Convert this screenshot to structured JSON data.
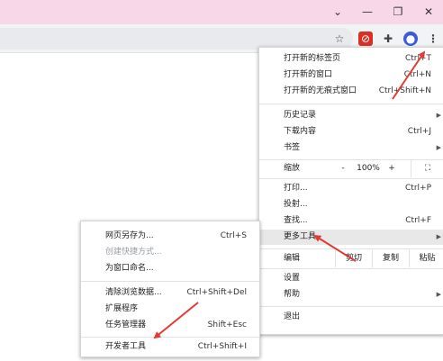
{
  "window": {
    "minimize_icon": "—",
    "restore_icon": "❐",
    "close_icon": "✕",
    "tab_dropdown_icon": "⌄"
  },
  "toolbar": {
    "star_icon": "☆",
    "ext1_icon": "⊘",
    "puzzle_icon": "✚",
    "profile_icon": "●",
    "menu_icon": "⋮"
  },
  "menu": {
    "items": [
      {
        "label": "打开新的标签页",
        "shortcut": "Ctrl+T"
      },
      {
        "label": "打开新的窗口",
        "shortcut": "Ctrl+N"
      },
      {
        "label": "打开新的无痕式窗口",
        "shortcut": "Ctrl+Shift+N"
      },
      {
        "label": "历史记录",
        "shortcut": ""
      },
      {
        "label": "下载内容",
        "shortcut": "Ctrl+J"
      },
      {
        "label": "书签",
        "shortcut": ""
      },
      {
        "label": "打印...",
        "shortcut": "Ctrl+P"
      },
      {
        "label": "投射...",
        "shortcut": ""
      },
      {
        "label": "查找...",
        "shortcut": "Ctrl+F"
      },
      {
        "label": "更多工具",
        "shortcut": ""
      },
      {
        "label": "设置",
        "shortcut": ""
      },
      {
        "label": "帮助",
        "shortcut": ""
      },
      {
        "label": "退出",
        "shortcut": ""
      }
    ],
    "zoom": {
      "label": "缩放",
      "minus": "-",
      "value": "100%",
      "plus": "+",
      "fullscreen_icon": "⛶"
    },
    "edit": {
      "label": "编辑",
      "cut": "剪切",
      "copy": "复制",
      "paste": "粘贴"
    },
    "submenu_arrow": "▶"
  },
  "submenu": {
    "items": [
      {
        "label": "网页另存为...",
        "shortcut": "Ctrl+S",
        "disabled": false
      },
      {
        "label": "创建快捷方式...",
        "shortcut": "",
        "disabled": true
      },
      {
        "label": "为窗口命名...",
        "shortcut": "",
        "disabled": false
      },
      {
        "label": "清除浏览数据...",
        "shortcut": "Ctrl+Shift+Del",
        "disabled": false
      },
      {
        "label": "扩展程序",
        "shortcut": "",
        "disabled": false
      },
      {
        "label": "任务管理器",
        "shortcut": "Shift+Esc",
        "disabled": false
      },
      {
        "label": "开发者工具",
        "shortcut": "Ctrl+Shift+I",
        "disabled": false
      }
    ]
  },
  "colors": {
    "titlebar": "#f8d7e8",
    "annotation_arrow": "#e53935",
    "profile": "#3b5bdb"
  }
}
